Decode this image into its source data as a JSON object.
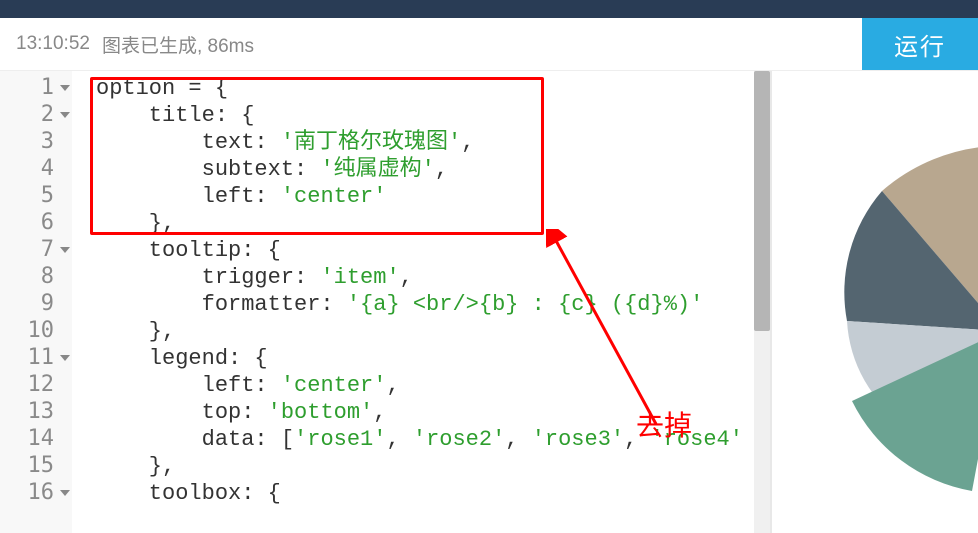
{
  "status": {
    "time": "13:10:52",
    "message": "图表已生成, 86ms"
  },
  "actions": {
    "run_label": "运行"
  },
  "annotation": {
    "label": "去掉"
  },
  "editor": {
    "lines": [
      "option = {",
      "    title: {",
      "        text: '南丁格尔玫瑰图',",
      "        subtext: '纯属虚构',",
      "        left: 'center'",
      "    },",
      "    tooltip: {",
      "        trigger: 'item',",
      "        formatter: '{a} <br/>{b} : {c} ({d}%)'",
      "    },",
      "    legend: {",
      "        left: 'center',",
      "        top: 'bottom',",
      "        data: ['rose1', 'rose2', 'rose3', 'rose4'",
      "    },",
      "    toolbox: {"
    ],
    "fold_lines": [
      1,
      2,
      7,
      11,
      16
    ]
  }
}
